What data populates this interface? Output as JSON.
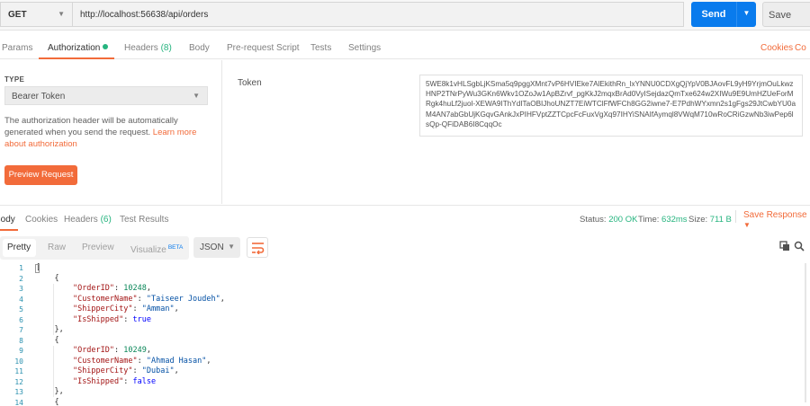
{
  "request": {
    "method": "GET",
    "url": "http://localhost:56638/api/orders",
    "send_label": "Send",
    "save_label": "Save"
  },
  "request_tabs": {
    "params": "Params",
    "authorization": "Authorization",
    "headers": "Headers",
    "headers_count": "(8)",
    "body": "Body",
    "prerequest": "Pre-request Script",
    "tests": "Tests",
    "settings": "Settings",
    "cookies": "Cookies",
    "code": "Co"
  },
  "auth": {
    "type_label": "TYPE",
    "type_value": "Bearer Token",
    "description": "The authorization header will be automatically generated when you send the request. ",
    "learn_more": "Learn more about authorization",
    "preview_button": "Preview Request",
    "token_label": "Token",
    "token_value": "5WE8k1vHLSgbLjKSma5q9pggXMnt7vP6HVIEke7AlEkithRn_lxYNNU0CDXgQjYpV0BJAovFL9yH9YrjmOuLkwzHNP2TNrPyWu3GKn6Wkv1OZoJw1ApBZrvf_pgKkJ2mqxBrAd0VyISejdazQmTxe624w2XIWu9E9UmHZUeForMRgk4huLf2juol-XEWA9IThYdITaOBIJhoUNZT7EiWTClFfWFCh8GG2iwne7-E7PdhWYxmn2s1gFgs29JtCwbYU0aM4AN7abGbUjKGqvGAnkJxPIHFVptZZTCpcFcFuxVgXq97IHYiSNAIfAymql8VWqM710wRoCRiGzwNb3iwPep6lsQp-QFiDAB6I8CqqOc"
  },
  "response_tabs": {
    "body": "Body",
    "cookies": "Cookies",
    "headers": "Headers",
    "headers_count": "(6)",
    "test_results": "Test Results"
  },
  "response_status": {
    "status_label": "Status:",
    "status_value": "200 OK",
    "time_label": "Time:",
    "time_value": "632ms",
    "size_label": "Size:",
    "size_value": "711 B",
    "save_response": "Save Response"
  },
  "response_toolbar": {
    "pretty": "Pretty",
    "raw": "Raw",
    "preview": "Preview",
    "visualize": "Visualize",
    "beta": "BETA",
    "format": "JSON"
  },
  "response_lines": [
    {
      "num": "1",
      "html": "["
    },
    {
      "num": "2",
      "html": "    {"
    },
    {
      "num": "3",
      "html": "        <span class='k'>\"OrderID\"</span>: <span class='n'>10248</span>,"
    },
    {
      "num": "4",
      "html": "        <span class='k'>\"CustomerName\"</span>: <span class='s'>\"Taiseer Joudeh\"</span>,"
    },
    {
      "num": "5",
      "html": "        <span class='k'>\"ShipperCity\"</span>: <span class='s'>\"Amman\"</span>,"
    },
    {
      "num": "6",
      "html": "        <span class='k'>\"IsShipped\"</span>: <span class='b'>true</span>"
    },
    {
      "num": "7",
      "html": "    },"
    },
    {
      "num": "8",
      "html": "    {"
    },
    {
      "num": "9",
      "html": "        <span class='k'>\"OrderID\"</span>: <span class='n'>10249</span>,"
    },
    {
      "num": "10",
      "html": "        <span class='k'>\"CustomerName\"</span>: <span class='s'>\"Ahmad Hasan\"</span>,"
    },
    {
      "num": "11",
      "html": "        <span class='k'>\"ShipperCity\"</span>: <span class='s'>\"Dubai\"</span>,"
    },
    {
      "num": "12",
      "html": "        <span class='k'>\"IsShipped\"</span>: <span class='b'>false</span>"
    },
    {
      "num": "13",
      "html": "    },"
    },
    {
      "num": "14",
      "html": "    {"
    }
  ],
  "colors": {
    "accent": "#f26b3a",
    "send": "#097bed",
    "success": "#26b47f"
  }
}
